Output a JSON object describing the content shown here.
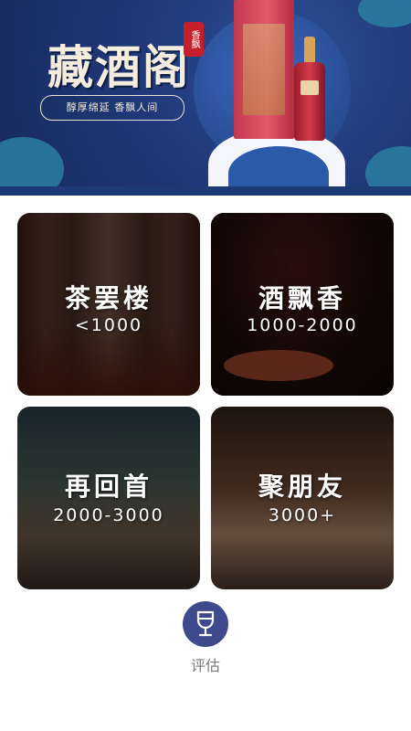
{
  "banner": {
    "title": "藏酒阁",
    "slogan": "醇厚绵延 香飘人间",
    "seal": "香飘"
  },
  "cards": [
    {
      "name": "茶罢楼",
      "price": "<1000"
    },
    {
      "name": "酒飘香",
      "price": "1000-2000"
    },
    {
      "name": "再回首",
      "price": "2000-3000"
    },
    {
      "name": "聚朋友",
      "price": "3000+"
    }
  ],
  "bottom_nav": {
    "label": "评估",
    "icon": "wine-glass-icon",
    "accent_color": "#3e4a8c"
  }
}
